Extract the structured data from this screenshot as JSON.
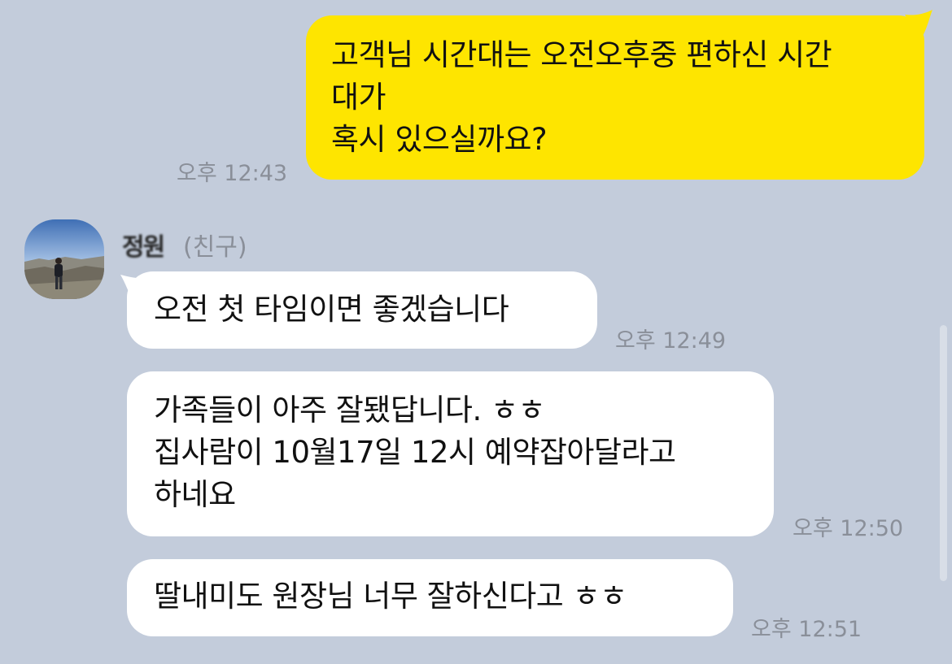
{
  "colors": {
    "background": "#c3ccdb",
    "outgoing_bubble": "#fee500",
    "incoming_bubble": "#ffffff",
    "timestamp": "#8a8f99"
  },
  "messages": {
    "outgoing_1": {
      "text": "고객님 시간대는 오전오후중 편하신 시간\n대가\n혹시 있으실까요?",
      "time": "오후 12:43"
    },
    "incoming": {
      "sender_name": "정원",
      "sender_tag": "(친구)",
      "avatar_icon": "profile-photo-avatar",
      "items": [
        {
          "text": "오전 첫 타임이면 좋겠습니다",
          "time": "오후 12:49"
        },
        {
          "text": "가족들이 아주 잘됐답니다. ㅎㅎ\n집사람이 10월17일 12시 예약잡아달라고\n하네요",
          "time": "오후 12:50"
        },
        {
          "text": "딸내미도 원장님 너무 잘하신다고  ㅎㅎ",
          "time": "오후 12:51"
        }
      ]
    }
  }
}
